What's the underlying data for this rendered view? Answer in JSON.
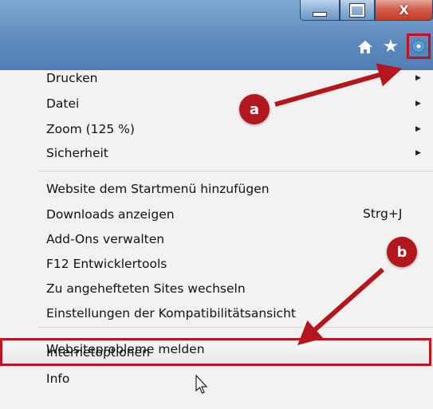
{
  "window": {
    "close_glyph": "X"
  },
  "toolbar": {
    "icons": [
      "home-icon",
      "star-icon",
      "gear-icon"
    ]
  },
  "menu": {
    "items": [
      {
        "label": "Drucken",
        "submenu": true
      },
      {
        "label": "Datei",
        "submenu": true
      },
      {
        "label": "Zoom (125 %)",
        "submenu": true
      },
      {
        "label": "Sicherheit",
        "submenu": true
      },
      {
        "label": "Website dem Startmenü hinzufügen",
        "submenu": false
      },
      {
        "label": "Downloads anzeigen",
        "submenu": false,
        "shortcut": "Strg+J"
      },
      {
        "label": "Add-Ons verwalten",
        "submenu": false
      },
      {
        "label": "F12 Entwicklertools",
        "submenu": false
      },
      {
        "label": "Zu angehefteten Sites wechseln",
        "submenu": false
      },
      {
        "label": "Einstellungen der Kompatibilitätsansicht",
        "submenu": false
      },
      {
        "label": "Websiteprobleme melden",
        "submenu": false
      },
      {
        "label": "Internetoptionen",
        "submenu": false,
        "highlighted": true
      },
      {
        "label": "Info",
        "submenu": false
      }
    ]
  },
  "annotations": {
    "callout_a": "a",
    "callout_b": "b",
    "highlight_color": "#c0131c"
  }
}
